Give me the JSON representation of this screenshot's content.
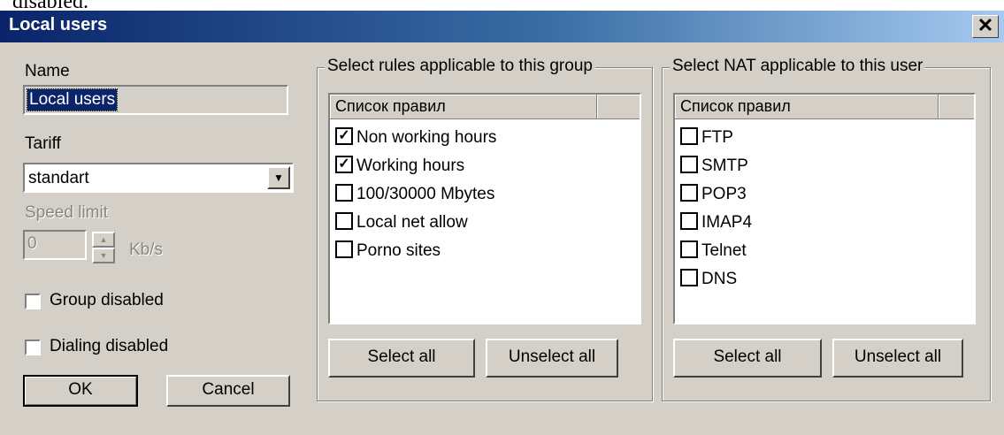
{
  "cropped_text": "disabled.",
  "window": {
    "title": "Local users",
    "close_glyph": "✕"
  },
  "left": {
    "name_label": "Name",
    "name_value": "Local users",
    "tariff_label": "Tariff",
    "tariff_value": "standart",
    "speed_label": "Speed limit",
    "speed_value": "0",
    "speed_unit": "Kb/s",
    "group_disabled_label": "Group disabled",
    "group_disabled_checked": false,
    "dialing_disabled_label": "Dialing disabled",
    "dialing_disabled_checked": false,
    "ok_label": "OK",
    "cancel_label": "Cancel"
  },
  "rules_group": {
    "title": "Select rules applicable to this group",
    "column_header": "Список правил",
    "items": [
      {
        "label": "Non working hours",
        "checked": true
      },
      {
        "label": "Working hours",
        "checked": true
      },
      {
        "label": "100/30000 Mbytes",
        "checked": false
      },
      {
        "label": "Local net allow",
        "checked": false
      },
      {
        "label": "Porno sites",
        "checked": false
      }
    ],
    "select_all_label": "Select all",
    "unselect_all_label": "Unselect all"
  },
  "nat_group": {
    "title": "Select NAT applicable to this user",
    "column_header": "Список правил",
    "items": [
      {
        "label": "FTP",
        "checked": false
      },
      {
        "label": "SMTP",
        "checked": false
      },
      {
        "label": "POP3",
        "checked": false
      },
      {
        "label": "IMAP4",
        "checked": false
      },
      {
        "label": "Telnet",
        "checked": false
      },
      {
        "label": "DNS",
        "checked": false
      }
    ],
    "select_all_label": "Select all",
    "unselect_all_label": "Unselect all"
  }
}
